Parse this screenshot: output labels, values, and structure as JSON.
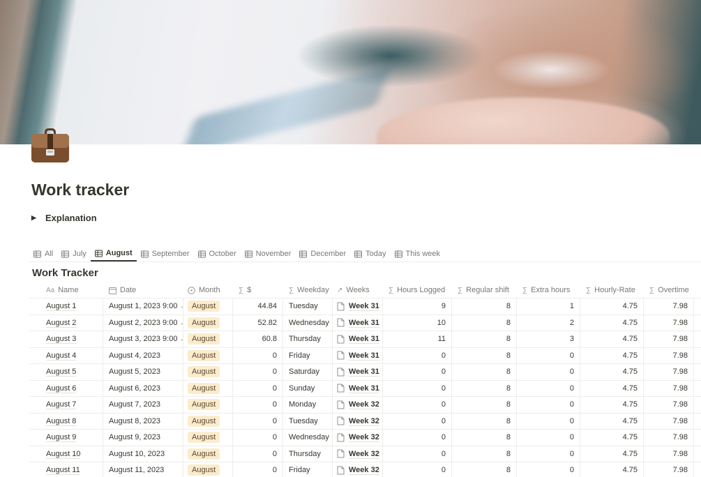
{
  "page": {
    "title": "Work tracker",
    "icon": "briefcase-icon",
    "cover": "blurred-laptop-typing-photo",
    "toggle_label": "Explanation"
  },
  "views": [
    {
      "label": "All",
      "icon": "table-icon",
      "active": false
    },
    {
      "label": "July",
      "icon": "table-icon",
      "active": false
    },
    {
      "label": "August",
      "icon": "table-icon",
      "active": true
    },
    {
      "label": "September",
      "icon": "table-icon",
      "active": false
    },
    {
      "label": "October",
      "icon": "table-icon",
      "active": false
    },
    {
      "label": "November",
      "icon": "table-icon",
      "active": false
    },
    {
      "label": "December",
      "icon": "table-icon",
      "active": false
    },
    {
      "label": "Today",
      "icon": "table-icon",
      "active": false
    },
    {
      "label": "This week",
      "icon": "table-icon",
      "active": false
    }
  ],
  "database": {
    "title": "Work Tracker",
    "columns": [
      {
        "label": "Name",
        "icon": "Aa"
      },
      {
        "label": "Date",
        "icon": "calendar-icon"
      },
      {
        "label": "Month",
        "icon": "select-icon"
      },
      {
        "label": "$",
        "icon": "formula-icon"
      },
      {
        "label": "Weekday",
        "icon": "formula-icon"
      },
      {
        "label": "Weeks",
        "icon": "relation-icon"
      },
      {
        "label": "Hours Logged",
        "icon": "formula-icon"
      },
      {
        "label": "Regular shift",
        "icon": "formula-icon"
      },
      {
        "label": "Extra hours",
        "icon": "formula-icon"
      },
      {
        "label": "Hourly-Rate",
        "icon": "formula-icon"
      },
      {
        "label": "Overtime",
        "icon": "formula-icon"
      }
    ],
    "tag_color": "#fbeccc",
    "rows": [
      {
        "name": "August 1",
        "date": "August 1, 2023 9:00 →",
        "month": "August",
        "dollar": "44.84",
        "weekday": "Tuesday",
        "week": "Week 31",
        "hours": "9",
        "regular": "8",
        "extra": "1",
        "rate": "4.75",
        "overtime": "7.98"
      },
      {
        "name": "August 2",
        "date": "August 2, 2023 9:00 →",
        "month": "August",
        "dollar": "52.82",
        "weekday": "Wednesday",
        "week": "Week 31",
        "hours": "10",
        "regular": "8",
        "extra": "2",
        "rate": "4.75",
        "overtime": "7.98"
      },
      {
        "name": "August 3",
        "date": "August 3, 2023 9:00 →",
        "month": "August",
        "dollar": "60.8",
        "weekday": "Thursday",
        "week": "Week 31",
        "hours": "11",
        "regular": "8",
        "extra": "3",
        "rate": "4.75",
        "overtime": "7.98"
      },
      {
        "name": "August 4",
        "date": "August 4, 2023",
        "month": "August",
        "dollar": "0",
        "weekday": "Friday",
        "week": "Week 31",
        "hours": "0",
        "regular": "8",
        "extra": "0",
        "rate": "4.75",
        "overtime": "7.98"
      },
      {
        "name": "August 5",
        "date": "August 5, 2023",
        "month": "August",
        "dollar": "0",
        "weekday": "Saturday",
        "week": "Week 31",
        "hours": "0",
        "regular": "8",
        "extra": "0",
        "rate": "4.75",
        "overtime": "7.98"
      },
      {
        "name": "August 6",
        "date": "August 6, 2023",
        "month": "August",
        "dollar": "0",
        "weekday": "Sunday",
        "week": "Week 31",
        "hours": "0",
        "regular": "8",
        "extra": "0",
        "rate": "4.75",
        "overtime": "7.98"
      },
      {
        "name": "August 7",
        "date": "August 7, 2023",
        "month": "August",
        "dollar": "0",
        "weekday": "Monday",
        "week": "Week 32",
        "hours": "0",
        "regular": "8",
        "extra": "0",
        "rate": "4.75",
        "overtime": "7.98"
      },
      {
        "name": "August 8",
        "date": "August 8, 2023",
        "month": "August",
        "dollar": "0",
        "weekday": "Tuesday",
        "week": "Week 32",
        "hours": "0",
        "regular": "8",
        "extra": "0",
        "rate": "4.75",
        "overtime": "7.98"
      },
      {
        "name": "August 9",
        "date": "August 9, 2023",
        "month": "August",
        "dollar": "0",
        "weekday": "Wednesday",
        "week": "Week 32",
        "hours": "0",
        "regular": "8",
        "extra": "0",
        "rate": "4.75",
        "overtime": "7.98"
      },
      {
        "name": "August 10",
        "date": "August 10, 2023",
        "month": "August",
        "dollar": "0",
        "weekday": "Thursday",
        "week": "Week 32",
        "hours": "0",
        "regular": "8",
        "extra": "0",
        "rate": "4.75",
        "overtime": "7.98"
      },
      {
        "name": "August 11",
        "date": "August 11, 2023",
        "month": "August",
        "dollar": "0",
        "weekday": "Friday",
        "week": "Week 32",
        "hours": "0",
        "regular": "8",
        "extra": "0",
        "rate": "4.75",
        "overtime": "7.98"
      }
    ]
  }
}
